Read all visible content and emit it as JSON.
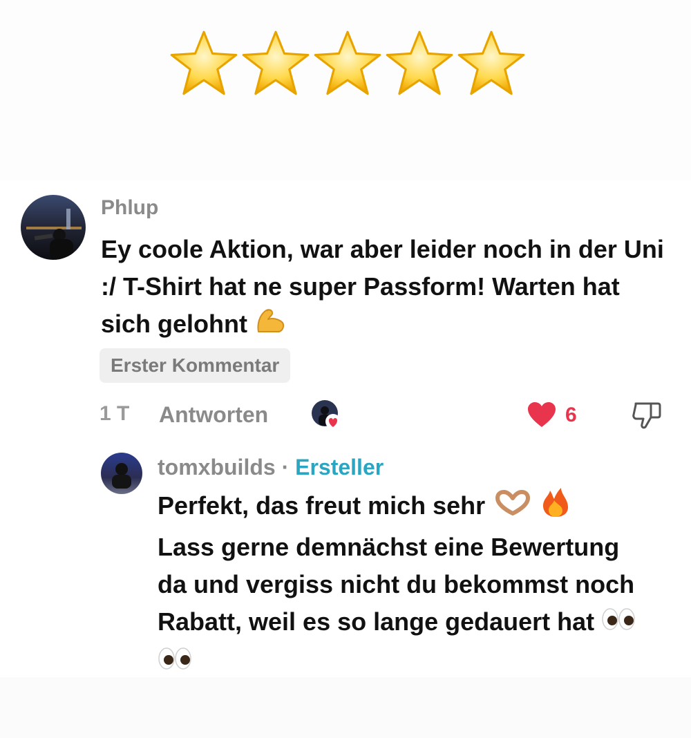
{
  "rating": {
    "stars": 5,
    "max": 5,
    "star_icon": "star-emoji"
  },
  "comment": {
    "username": "Phlup",
    "text": "Ey coole Aktion, war aber leider noch in der Uni :/ T-Shirt hat ne super Passform! Warten hat sich gelohnt",
    "text_emoji": "flexed-biceps-emoji",
    "badge": "Erster Kommentar",
    "time": "1 T",
    "reply_label": "Antworten",
    "likes": "6",
    "colors": {
      "like": "#e8344d",
      "muted": "#8a8a8a"
    }
  },
  "reply": {
    "username": "tomxbuilds",
    "separator": "·",
    "creator_label": "Ersteller",
    "line1": "Perfekt, das freut mich sehr",
    "line1_emojis": [
      "heart-hands-emoji",
      "fire-emoji"
    ],
    "text": "Lass gerne demnächst eine Bewertung da und vergiss nicht du bekommst noch Rabatt, weil es so lange gedauert hat",
    "text_emojis": [
      "eyes-emoji",
      "eyes-emoji"
    ],
    "colors": {
      "creator": "#2aa6c2"
    }
  }
}
